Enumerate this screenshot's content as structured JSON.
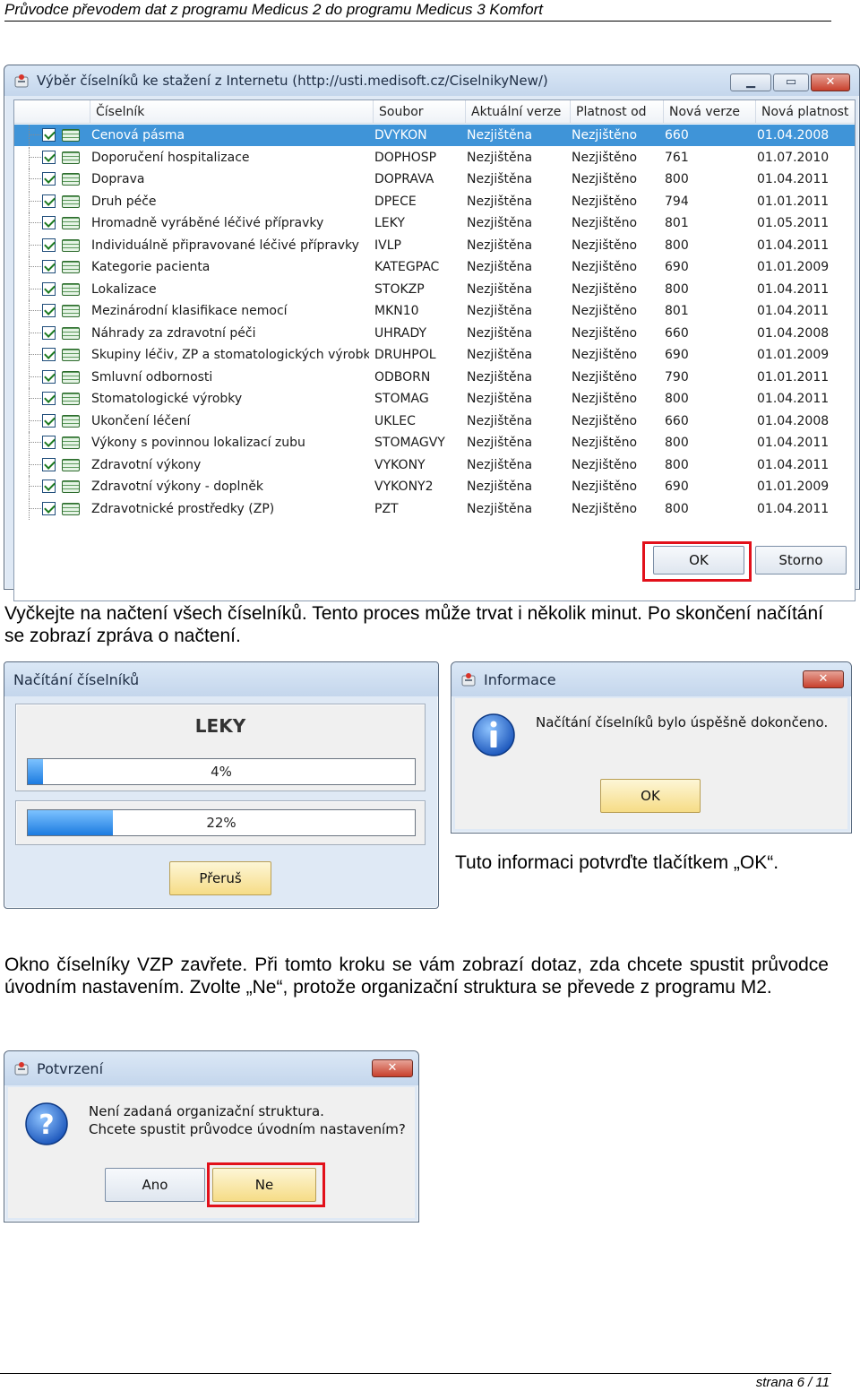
{
  "header": {
    "title": "Průvodce převodem dat z programu Medicus 2 do programu Medicus 3 Komfort"
  },
  "dialog_catalogs": {
    "title": "Výběr číselníků ke stažení z Internetu (http://usti.medisoft.cz/CiselnikyNew/)",
    "columns": [
      "Číselník",
      "Soubor",
      "Aktuální verze",
      "Platnost od",
      "Nová verze",
      "Nová platnost"
    ],
    "rows": [
      [
        "Cenová pásma",
        "DVYKON",
        "Nezjištěna",
        "Nezjištěno",
        "660",
        "01.04.2008"
      ],
      [
        "Doporučení hospitalizace",
        "DOPHOSP",
        "Nezjištěna",
        "Nezjištěno",
        "761",
        "01.07.2010"
      ],
      [
        "Doprava",
        "DOPRAVA",
        "Nezjištěna",
        "Nezjištěno",
        "800",
        "01.04.2011"
      ],
      [
        "Druh péče",
        "DPECE",
        "Nezjištěna",
        "Nezjištěno",
        "794",
        "01.01.2011"
      ],
      [
        "Hromadně vyráběné léčivé přípravky",
        "LEKY",
        "Nezjištěna",
        "Nezjištěno",
        "801",
        "01.05.2011"
      ],
      [
        "Individuálně připravované léčivé přípravky",
        "IVLP",
        "Nezjištěna",
        "Nezjištěno",
        "800",
        "01.04.2011"
      ],
      [
        "Kategorie pacienta",
        "KATEGPAC",
        "Nezjištěna",
        "Nezjištěno",
        "690",
        "01.01.2009"
      ],
      [
        "Lokalizace",
        "STOKZP",
        "Nezjištěna",
        "Nezjištěno",
        "800",
        "01.04.2011"
      ],
      [
        "Mezinárodní klasifikace nemocí",
        "MKN10",
        "Nezjištěna",
        "Nezjištěno",
        "801",
        "01.04.2011"
      ],
      [
        "Náhrady za zdravotní péči",
        "UHRADY",
        "Nezjištěna",
        "Nezjištěno",
        "660",
        "01.04.2008"
      ],
      [
        "Skupiny léčiv, ZP a stomatologických výrobků",
        "DRUHPOL",
        "Nezjištěna",
        "Nezjištěno",
        "690",
        "01.01.2009"
      ],
      [
        "Smluvní odbornosti",
        "ODBORN",
        "Nezjištěna",
        "Nezjištěno",
        "790",
        "01.01.2011"
      ],
      [
        "Stomatologické výrobky",
        "STOMAG",
        "Nezjištěna",
        "Nezjištěno",
        "800",
        "01.04.2011"
      ],
      [
        "Ukončení léčení",
        "UKLEC",
        "Nezjištěna",
        "Nezjištěno",
        "660",
        "01.04.2008"
      ],
      [
        "Výkony s povinnou lokalizací zubu",
        "STOMAGVY",
        "Nezjištěna",
        "Nezjištěno",
        "800",
        "01.04.2011"
      ],
      [
        "Zdravotní výkony",
        "VYKONY",
        "Nezjištěna",
        "Nezjištěno",
        "800",
        "01.04.2011"
      ],
      [
        "Zdravotní výkony - doplněk",
        "VYKONY2",
        "Nezjištěna",
        "Nezjištěno",
        "690",
        "01.01.2009"
      ],
      [
        "Zdravotnické prostředky (ZP)",
        "PZT",
        "Nezjištěna",
        "Nezjištěno",
        "800",
        "01.04.2011"
      ]
    ],
    "ok_label": "OK",
    "cancel_label": "Storno"
  },
  "text1": "Vyčkejte na načtení všech číselníků. Tento proces může trvat i několik minut. Po skončení načítání se zobrazí zpráva o načtení.",
  "dialog_loading": {
    "title": "Načítání číselníků",
    "current_item": "LEKY",
    "progress1": {
      "label": "4%",
      "value": 0.04
    },
    "progress2": {
      "label": "22%",
      "value": 0.22
    },
    "abort_label": "Přeruš"
  },
  "dialog_info": {
    "title": "Informace",
    "message": "Načítání číselníků bylo úspěšně dokončeno.",
    "ok_label": "OK"
  },
  "text2": "Tuto informaci potvrďte tlačítkem „OK“.",
  "text3": "Okno číselníky VZP zavřete. Při tomto kroku se vám zobrazí dotaz, zda chcete spustit průvodce úvodním nastavením. Zvolte „Ne“, protože organizační struktura se převede z programu M2.",
  "dialog_confirm": {
    "title": "Potvrzení",
    "line1": "Není zadaná organizační struktura.",
    "line2": "Chcete spustit průvodce úvodním nastavením?",
    "yes_label": "Ano",
    "no_label": "Ne"
  },
  "footer": {
    "page": "strana 6 / 11"
  },
  "colors": {
    "selection": "#3f94d8",
    "highlight_frame": "#e2101a",
    "titlebar": "#c4d6ec"
  }
}
